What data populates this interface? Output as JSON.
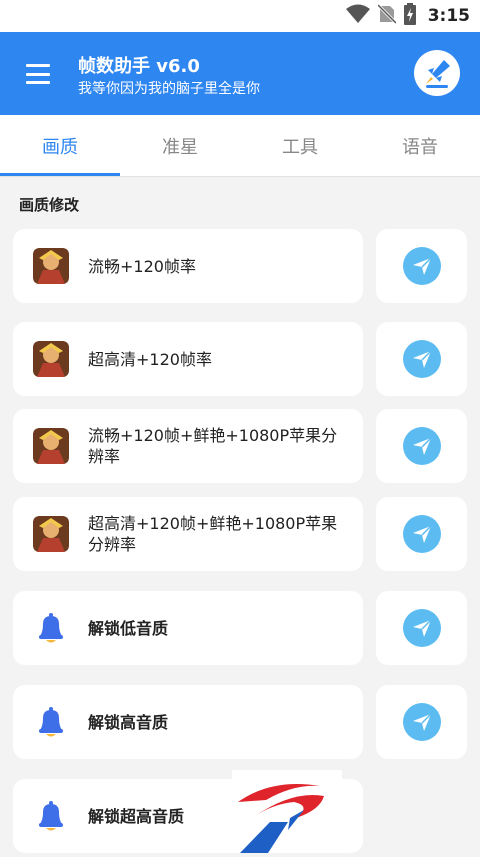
{
  "status_bar": {
    "time": "3:15",
    "icons": [
      "wifi-icon",
      "no-sim-icon",
      "battery-charging-icon"
    ]
  },
  "app_bar": {
    "menu_icon": "hamburger-menu-icon",
    "title": "帧数助手 v6.0",
    "subtitle": "我等你因为我的脑子里全是你",
    "logo_icon": "rocket-logo-icon"
  },
  "tabs": [
    {
      "label": "画质",
      "active": true
    },
    {
      "label": "准星",
      "active": false
    },
    {
      "label": "工具",
      "active": false
    },
    {
      "label": "语音",
      "active": false
    }
  ],
  "section_title": "画质修改",
  "rows": [
    {
      "label": "流畅+120帧率",
      "icon": "game-avatar-icon"
    },
    {
      "label": "超高清+120帧率",
      "icon": "game-avatar-icon"
    },
    {
      "label": "流畅+120帧+鲜艳+1080P苹果分辨率",
      "icon": "game-avatar-icon"
    },
    {
      "label": "超高清+120帧+鲜艳+1080P苹果分辨率",
      "icon": "game-avatar-icon"
    },
    {
      "label": "解锁低音质",
      "icon": "bell-icon"
    },
    {
      "label": "解锁高音质",
      "icon": "bell-icon"
    },
    {
      "label": "解锁超高音质",
      "icon": "bell-icon"
    }
  ],
  "colors": {
    "accent": "#2e86f0",
    "send_button": "#5cbcf2",
    "bell": "#3f6fe8",
    "bell_clapper": "#f6b73c",
    "watermark_red": "#e0242c",
    "watermark_blue": "#1d5fc4"
  }
}
